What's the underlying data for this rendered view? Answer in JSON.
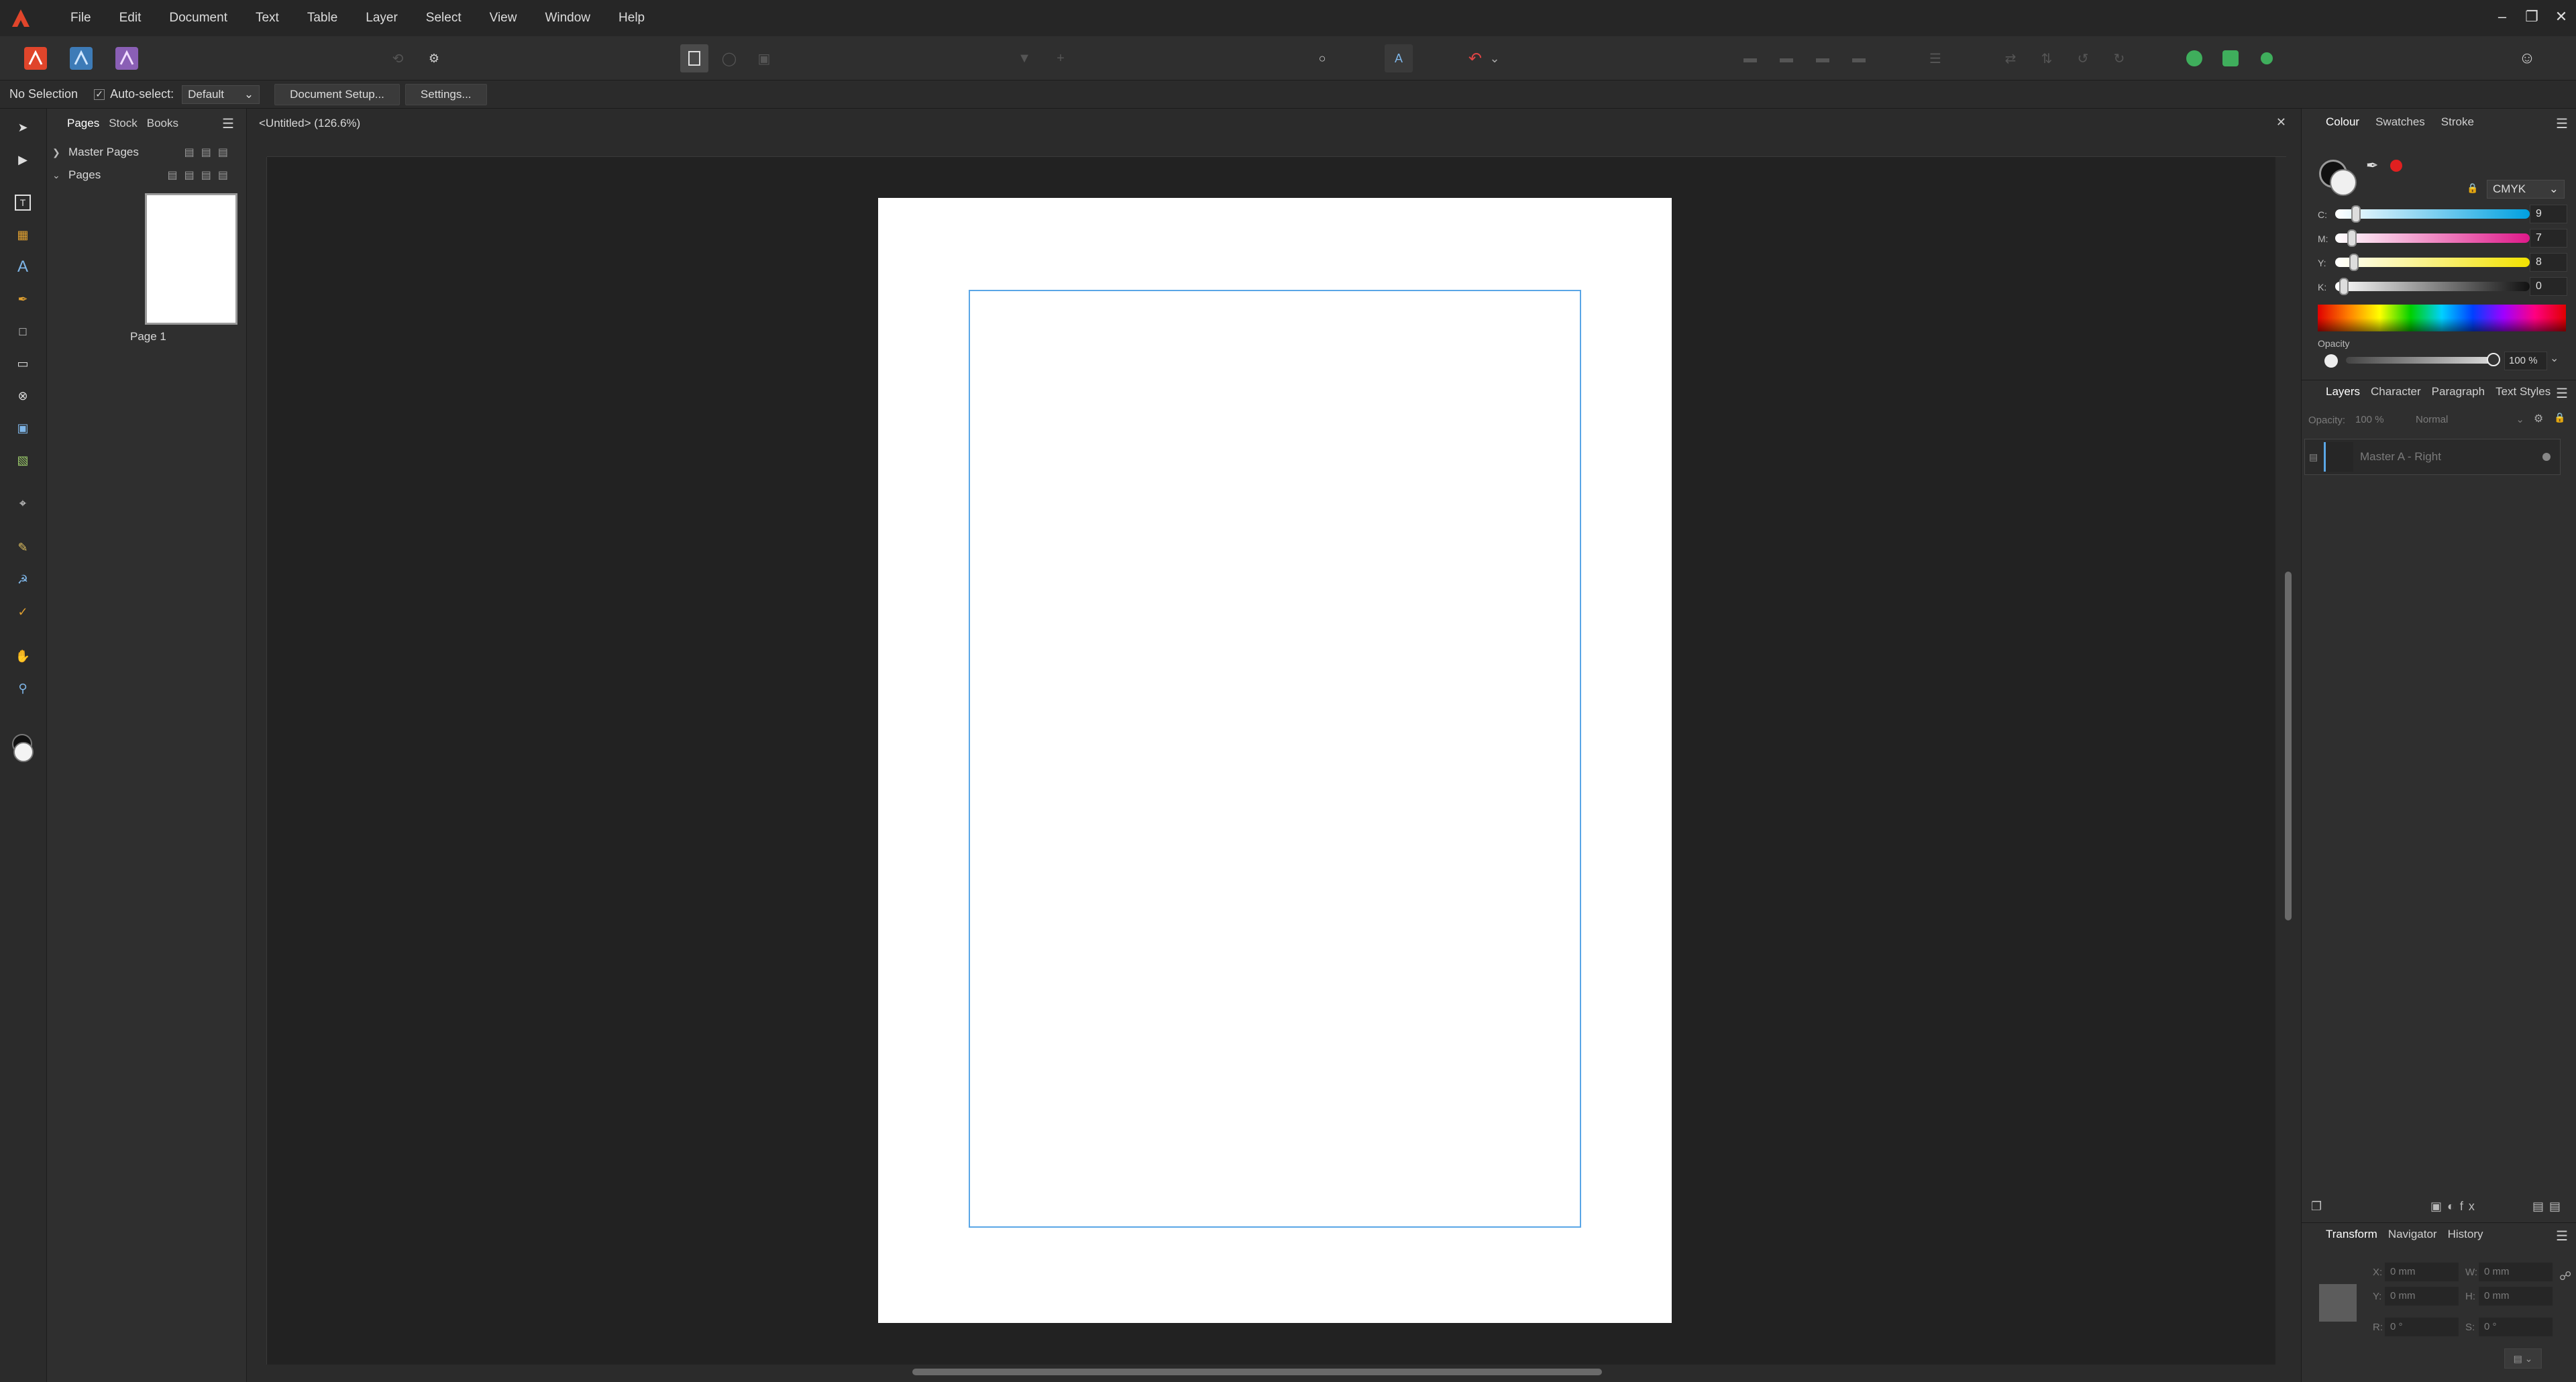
{
  "menu": {
    "items": [
      "File",
      "Edit",
      "Document",
      "Text",
      "Table",
      "Layer",
      "Select",
      "View",
      "Window",
      "Help"
    ]
  },
  "window_controls": [
    "minimize",
    "restore",
    "close"
  ],
  "context": {
    "selection": "No Selection",
    "auto_select_label": "Auto-select:",
    "auto_select_value": "Default",
    "document_setup": "Document Setup...",
    "settings": "Settings..."
  },
  "pages_panel": {
    "tabs": [
      "Pages",
      "Stock",
      "Books"
    ],
    "master_pages": "Master Pages",
    "pages": "Pages",
    "page_label": "Page 1"
  },
  "document": {
    "tab_title": "<Untitled> (126.6%)"
  },
  "colour_panel": {
    "tabs": [
      "Colour",
      "Swatches",
      "Stroke"
    ],
    "model": "CMYK",
    "channels": [
      {
        "label": "C:",
        "value": "9",
        "fraction": 0.09
      },
      {
        "label": "M:",
        "value": "7",
        "fraction": 0.07
      },
      {
        "label": "Y:",
        "value": "8",
        "fraction": 0.08
      },
      {
        "label": "K:",
        "value": "0",
        "fraction": 0.0
      }
    ],
    "opacity_label": "Opacity",
    "opacity_value": "100 %"
  },
  "layers_panel": {
    "tabs": [
      "Layers",
      "Character",
      "Paragraph",
      "Text Styles"
    ],
    "opacity_label": "Opacity:",
    "opacity_value": "100 %",
    "blend_mode": "Normal",
    "layer_name": "Master A - Right"
  },
  "transform_panel": {
    "tabs": [
      "Transform",
      "Navigator",
      "History"
    ],
    "x_label": "X:",
    "x_value": "0 mm",
    "y_label": "Y:",
    "y_value": "0 mm",
    "w_label": "W:",
    "w_value": "0 mm",
    "h_label": "H:",
    "h_value": "0 mm",
    "r_label": "R:",
    "r_value": "0 °",
    "s_label": "S:",
    "s_value": "0 °"
  },
  "colors": {
    "accent": "#5aa6e6",
    "brand_red": "#e0452b"
  }
}
